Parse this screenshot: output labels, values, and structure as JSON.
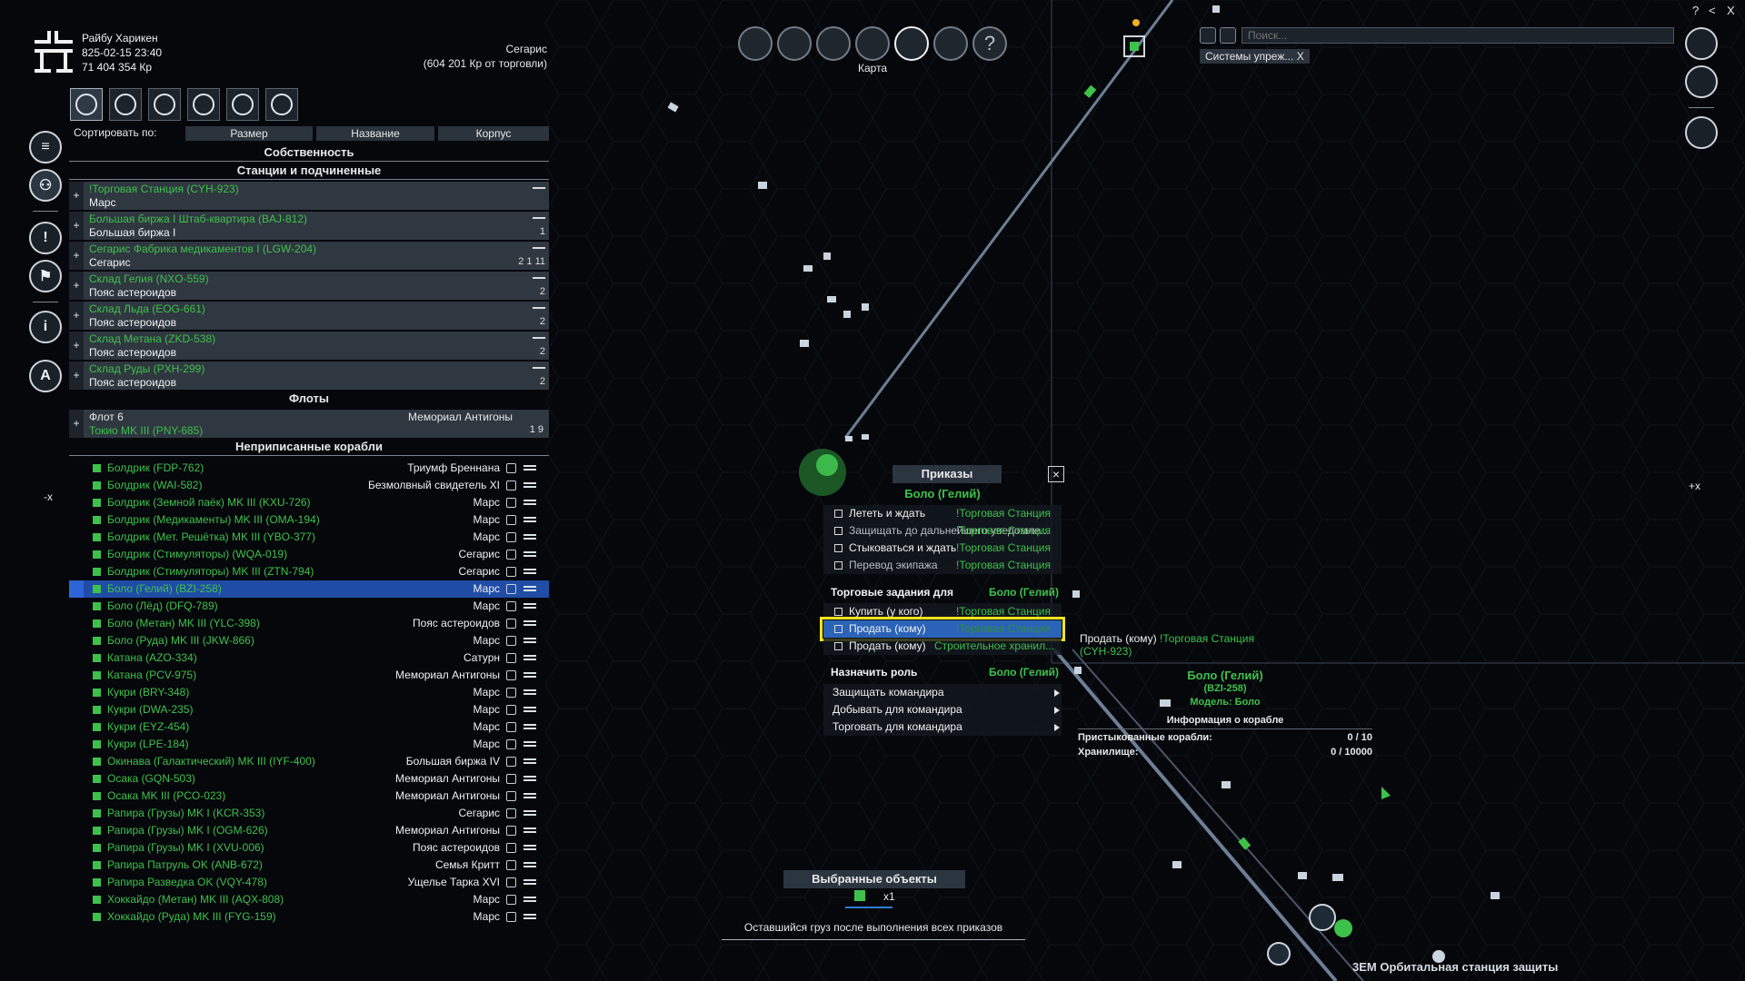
{
  "header": {
    "player_name": "Райбу Харикен",
    "datetime": "825-02-15 23:40",
    "credits": "71 404 354 Кр",
    "sector": "Сегарис",
    "trade_note": "(604 201 Кр от торговли)"
  },
  "sort": {
    "label": "Сортировать по:",
    "buttons": [
      "Размер",
      "Название",
      "Корпус"
    ]
  },
  "property": {
    "title": "Собственность",
    "stations_title": "Станции и подчиненные",
    "stations": [
      {
        "name": "!Торговая Станция  (CYH-923)",
        "location": "Марс",
        "counts": ""
      },
      {
        "name": "Большая биржа I Штаб-квартира (BAJ-812)",
        "location": "Большая биржа I",
        "counts": "1"
      },
      {
        "name": "Сегарис Фабрика медикаментов I (LGW-204)",
        "location": "Сегарис",
        "counts": "2  1  11"
      },
      {
        "name": "Склад Гелия (NXO-559)",
        "location": "Пояс астероидов",
        "counts": "2"
      },
      {
        "name": "Склад Льда (EOG-661)",
        "location": "Пояс астероидов",
        "counts": "2"
      },
      {
        "name": "Склад Метана (ZKD-538)",
        "location": "Пояс астероидов",
        "counts": "2"
      },
      {
        "name": "Склад Руды (PXH-299)",
        "location": "Пояс астероидов",
        "counts": "2"
      }
    ],
    "fleets_title": "Флоты",
    "fleet": {
      "name": "Флот 6",
      "location": "Мемориал Антигоны",
      "ship": "Токио MK III (PNY-685)",
      "counts": "1  9"
    },
    "unassigned_title": "Неприписанные корабли",
    "ships": [
      {
        "name": "Болдрик (FDP-762)",
        "location": "Триумф Бреннана"
      },
      {
        "name": "Болдрик (WAI-582)",
        "location": "Безмолвный свидетель XI"
      },
      {
        "name": "Болдрик (Земной паёк) MK III (KXU-726)",
        "location": "Марс"
      },
      {
        "name": "Болдрик (Медикаменты) MK III (OMA-194)",
        "location": "Марс"
      },
      {
        "name": "Болдрик (Мет. Решётка) MK III (YBO-377)",
        "location": "Марс"
      },
      {
        "name": "Болдрик (Стимуляторы) (WQA-019)",
        "location": "Сегарис"
      },
      {
        "name": "Болдрик (Стимуляторы) MK III  (ZTN-794)",
        "location": "Сегарис"
      },
      {
        "name": "Боло (Гелий)  (BZI-258)",
        "location": "Марс",
        "selected": true
      },
      {
        "name": "Боло (Лёд) (DFQ-789)",
        "location": "Марс"
      },
      {
        "name": "Боло (Метан) MK III (YLC-398)",
        "location": "Пояс астероидов"
      },
      {
        "name": "Боло (Руда) MK III (JKW-866)",
        "location": "Марс"
      },
      {
        "name": "Катана (AZO-334)",
        "location": "Сатурн"
      },
      {
        "name": "Катана (PCV-975)",
        "location": "Мемориал Антигоны"
      },
      {
        "name": "Кукри (BRY-348)",
        "location": "Марс"
      },
      {
        "name": "Кукри (DWA-235)",
        "location": "Марс"
      },
      {
        "name": "Кукри (EYZ-454)",
        "location": "Марс"
      },
      {
        "name": "Кукри (LPE-184)",
        "location": "Марс"
      },
      {
        "name": "Окинава (Галактический) MK III  (IYF-400)",
        "location": "Большая биржа IV"
      },
      {
        "name": "Осака (GQN-503)",
        "location": "Мемориал Антигоны"
      },
      {
        "name": "Осака MK III (PCO-023)",
        "location": "Мемориал Антигоны"
      },
      {
        "name": "Рапира (Грузы) MK I (KCR-353)",
        "location": "Сегарис"
      },
      {
        "name": "Рапира (Грузы) MK I (OGM-626)",
        "location": "Мемориал Антигоны"
      },
      {
        "name": "Рапира (Грузы) MK I (XVU-006)",
        "location": "Пояс астероидов"
      },
      {
        "name": "Рапира Патруль OK (ANB-672)",
        "location": "Семья Критт"
      },
      {
        "name": "Рапира Разведка OK (VQY-478)",
        "location": "Ущелье Тарка XVI"
      },
      {
        "name": "Хоккайдо (Метан) MK III (AQX-808)",
        "location": "Марс"
      },
      {
        "name": "Хоккайдо (Руда) MK III (FYG-159)",
        "location": "Марс"
      }
    ]
  },
  "toolbar": {
    "map_label": "Карта"
  },
  "search": {
    "placeholder": "Поиск...",
    "filter_chip": "Системы упреж... X"
  },
  "orders": {
    "title": "Приказы",
    "ship": "Боло (Гелий)",
    "items": [
      {
        "label": "Лететь и ждать",
        "target": "!Торговая Станция"
      },
      {
        "label": "Защищать до дальнейшего уведомле...",
        "target": "!Торговая Станция"
      },
      {
        "label": "Стыковаться и ждать",
        "target": "!Торговая Станция"
      },
      {
        "label": "Перевод экипажа",
        "target": "!Торговая Станция"
      }
    ],
    "trade_header": "Торговые задания для",
    "trade_ship": "Боло (Гелий)",
    "trade_items": [
      {
        "label": "Купить (у кого)",
        "target": "!Торговая Станция"
      },
      {
        "label": "Продать (кому)",
        "target": "!Торговая Станция"
      },
      {
        "label": "Продать (кому)",
        "target": "Строительное хранил..."
      }
    ],
    "role_header": "Назначить роль",
    "role_ship": "Боло (Гелий)",
    "role_items": [
      "Защищать командира",
      "Добывать для командира",
      "Торговать для командира"
    ]
  },
  "tooltip": {
    "action": "Продать (кому)",
    "target": "!Торговая Станция",
    "target_code": "(CYH-923)"
  },
  "ship_info": {
    "name": "Боло (Гелий)",
    "code": "(BZI-258)",
    "model": "Модель: Боло",
    "header": "Информация о корабле",
    "docked_label": "Пристыкованные корабли:",
    "docked_value": "0 / 10",
    "storage_label": "Хранилище:",
    "storage_value": "0 / 10000"
  },
  "selected_objects": {
    "title": "Выбранные объекты",
    "count": "x1",
    "cargo_note": "Оставшийся груз после выполнения всех приказов"
  },
  "map": {
    "station_label": "3ЕМ Орбитальная станция защиты",
    "edge_left": "-x",
    "edge_right": "+x"
  },
  "window": {
    "help": "?",
    "back": "<",
    "close": "X"
  }
}
